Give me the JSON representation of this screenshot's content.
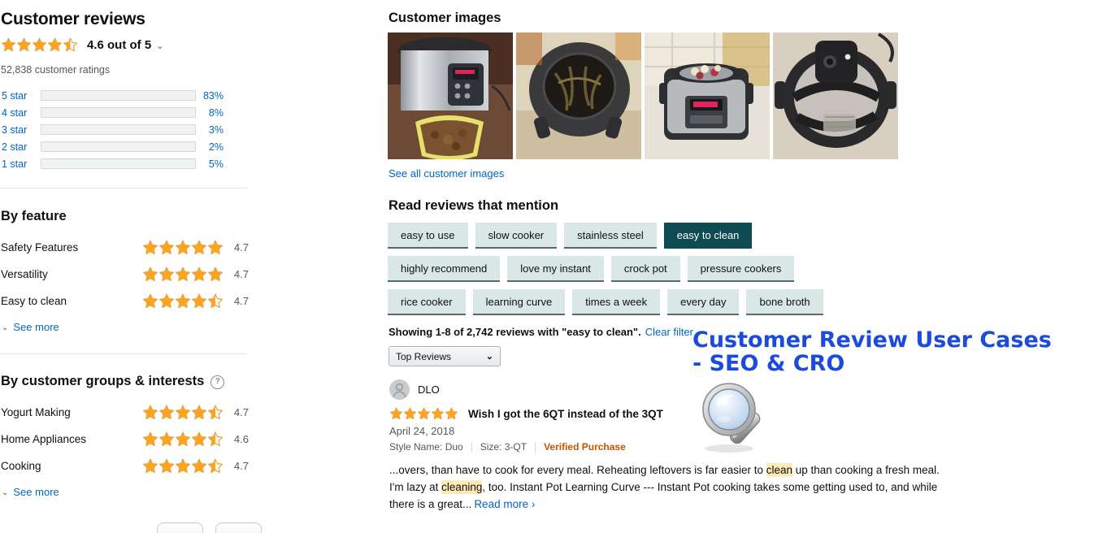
{
  "left": {
    "title": "Customer reviews",
    "overall": {
      "rating_value": 4.6,
      "stars_shown": 4.5,
      "text": "4.6 out of 5",
      "caret": "⌄"
    },
    "ratings_count": "52,838 customer ratings",
    "histogram": [
      {
        "label": "5 star",
        "percent": "83%",
        "value": 83
      },
      {
        "label": "4 star",
        "percent": "8%",
        "value": 8
      },
      {
        "label": "3 star",
        "percent": "3%",
        "value": 3
      },
      {
        "label": "2 star",
        "percent": "2%",
        "value": 2
      },
      {
        "label": "1 star",
        "percent": "5%",
        "value": 5
      }
    ],
    "by_feature": {
      "heading": "By feature",
      "rows": [
        {
          "name": "Safety Features",
          "score": "4.7",
          "stars": 5
        },
        {
          "name": "Versatility",
          "score": "4.7",
          "stars": 5
        },
        {
          "name": "Easy to clean",
          "score": "4.7",
          "stars": 4.5
        }
      ],
      "see_more": "See more"
    },
    "by_groups": {
      "heading": "By customer groups & interests",
      "help_glyph": "?",
      "rows": [
        {
          "name": "Yogurt Making",
          "score": "4.7",
          "stars": 4.5
        },
        {
          "name": "Home Appliances",
          "score": "4.6",
          "stars": 4.5
        },
        {
          "name": "Cooking",
          "score": "4.7",
          "stars": 4.5
        }
      ],
      "see_more": "See more"
    }
  },
  "right": {
    "customer_images": {
      "heading": "Customer images",
      "thumbs": [
        {
          "alt": "instant-pot-with-bowl-of-stew"
        },
        {
          "alt": "instant-pot-lid-underside-burnt"
        },
        {
          "alt": "instant-pot-with-apples-and-beets"
        },
        {
          "alt": "instant-pot-lid-sealing-ring"
        }
      ],
      "see_all": "See all customer images"
    },
    "mentions": {
      "heading": "Read reviews that mention",
      "rows": [
        [
          {
            "label": "easy to use",
            "selected": false
          },
          {
            "label": "slow cooker",
            "selected": false
          },
          {
            "label": "stainless steel",
            "selected": false
          },
          {
            "label": "easy to clean",
            "selected": true
          }
        ],
        [
          {
            "label": "highly recommend",
            "selected": false
          },
          {
            "label": "love my instant",
            "selected": false
          },
          {
            "label": "crock pot",
            "selected": false
          },
          {
            "label": "pressure cookers",
            "selected": false
          }
        ],
        [
          {
            "label": "rice cooker",
            "selected": false
          },
          {
            "label": "learning curve",
            "selected": false
          },
          {
            "label": "times a week",
            "selected": false
          },
          {
            "label": "every day",
            "selected": false
          },
          {
            "label": "bone broth",
            "selected": false
          }
        ]
      ]
    },
    "showing": {
      "text": "Showing 1-8 of 2,742 reviews with \"easy to clean\".",
      "clear_filter": "Clear filter"
    },
    "sort": {
      "value": "Top Reviews",
      "chevron": "⌄"
    },
    "review": {
      "author": "DLO",
      "stars": 5,
      "title": "Wish I got the 6QT instead of the 3QT",
      "date": "April 24, 2018",
      "style_name": "Style Name: Duo",
      "size": "Size: 3-QT",
      "verified": "Verified Purchase",
      "body_part1": "...overs, than have to cook for every meal. Reheating leftovers is far easier to ",
      "highlight1": "clean",
      "body_part2": " up than cooking a fresh meal. I'm lazy at ",
      "highlight2": "cleaning",
      "body_part3": ", too. Instant Pot Learning Curve --- Instant Pot cooking takes some getting used to, and while there is a great...",
      "read_more": "Read more ›"
    }
  },
  "overlay": {
    "line1": "Customer Review User Cases",
    "line2": "- SEO & CRO",
    "color": "#1a4bdc",
    "icon": "magnifying-glass"
  },
  "colors": {
    "star_gold": "#FFA41C",
    "link_blue": "#0066c0",
    "pill_bg": "#d9e7e7",
    "pill_selected_bg": "#0F4B53",
    "verified_orange": "#C45500",
    "highlight_yellow": "#feeab5"
  }
}
